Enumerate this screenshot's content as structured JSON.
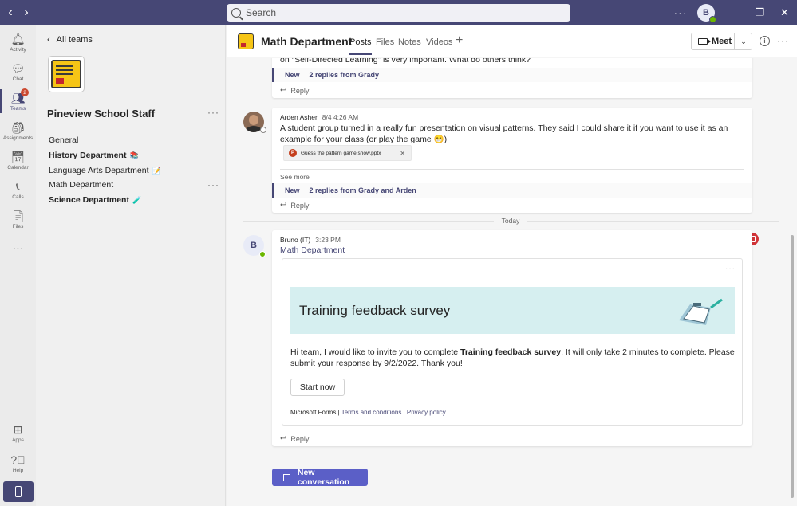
{
  "search": {
    "placeholder": "Search"
  },
  "user": {
    "initial": "B"
  },
  "rail": {
    "items": [
      {
        "label": "Activity",
        "icon": "bell-icon"
      },
      {
        "label": "Chat",
        "icon": "chat-icon"
      },
      {
        "label": "Teams",
        "icon": "teams-icon",
        "badge": "2"
      },
      {
        "label": "Assignments",
        "icon": "backpack-icon"
      },
      {
        "label": "Calendar",
        "icon": "calendar-icon"
      },
      {
        "label": "Calls",
        "icon": "phone-icon"
      },
      {
        "label": "Files",
        "icon": "file-icon"
      }
    ],
    "apps": "Apps",
    "help": "Help"
  },
  "panel": {
    "all_teams": "All teams",
    "team_name": "Pineview School Staff",
    "channels": [
      {
        "name": "General",
        "bold": false,
        "emoji": ""
      },
      {
        "name": "History Department",
        "bold": true,
        "emoji": "📚"
      },
      {
        "name": "Language Arts Department",
        "bold": false,
        "emoji": "📝"
      },
      {
        "name": "Math Department",
        "bold": false,
        "emoji": ""
      },
      {
        "name": "Science Department",
        "bold": true,
        "emoji": "🧪"
      }
    ]
  },
  "header": {
    "title": "Math Department",
    "tabs": [
      "Posts",
      "Files",
      "Notes",
      "Videos"
    ],
    "meet": "Meet"
  },
  "posts": {
    "top_text": "on “Self-Directed Learning” is very important. What do others think?",
    "top_new": "New",
    "top_replies": "2 replies from Grady",
    "reply": "Reply",
    "arden": {
      "author": "Arden Asher",
      "time": "8/4 4:26 AM",
      "text": "A student group turned in a really fun presentation on visual patterns. They said I could share it if you want to use it as an example for your class (or play the game 😁)",
      "attachment": "Guess the pattern game show.pptx",
      "see_more": "See more",
      "new": "New",
      "replies": "2 replies from Grady and Arden"
    },
    "today": "Today",
    "bruno": {
      "author": "Bruno (IT)",
      "time": "3:23 PM",
      "channel": "Math Department",
      "survey_title": "Training feedback survey",
      "body_pre": "Hi team, I would like to invite you to complete ",
      "body_bold": "Training feedback survey",
      "body_post": ". It will only take 2 minutes to complete. Please submit your response by 9/2/2022. Thank you!",
      "start": "Start now",
      "footer_brand": "Microsoft Forms",
      "footer_terms": "Terms and conditions",
      "footer_privacy": "Privacy policy"
    },
    "new_conversation": "New conversation"
  }
}
